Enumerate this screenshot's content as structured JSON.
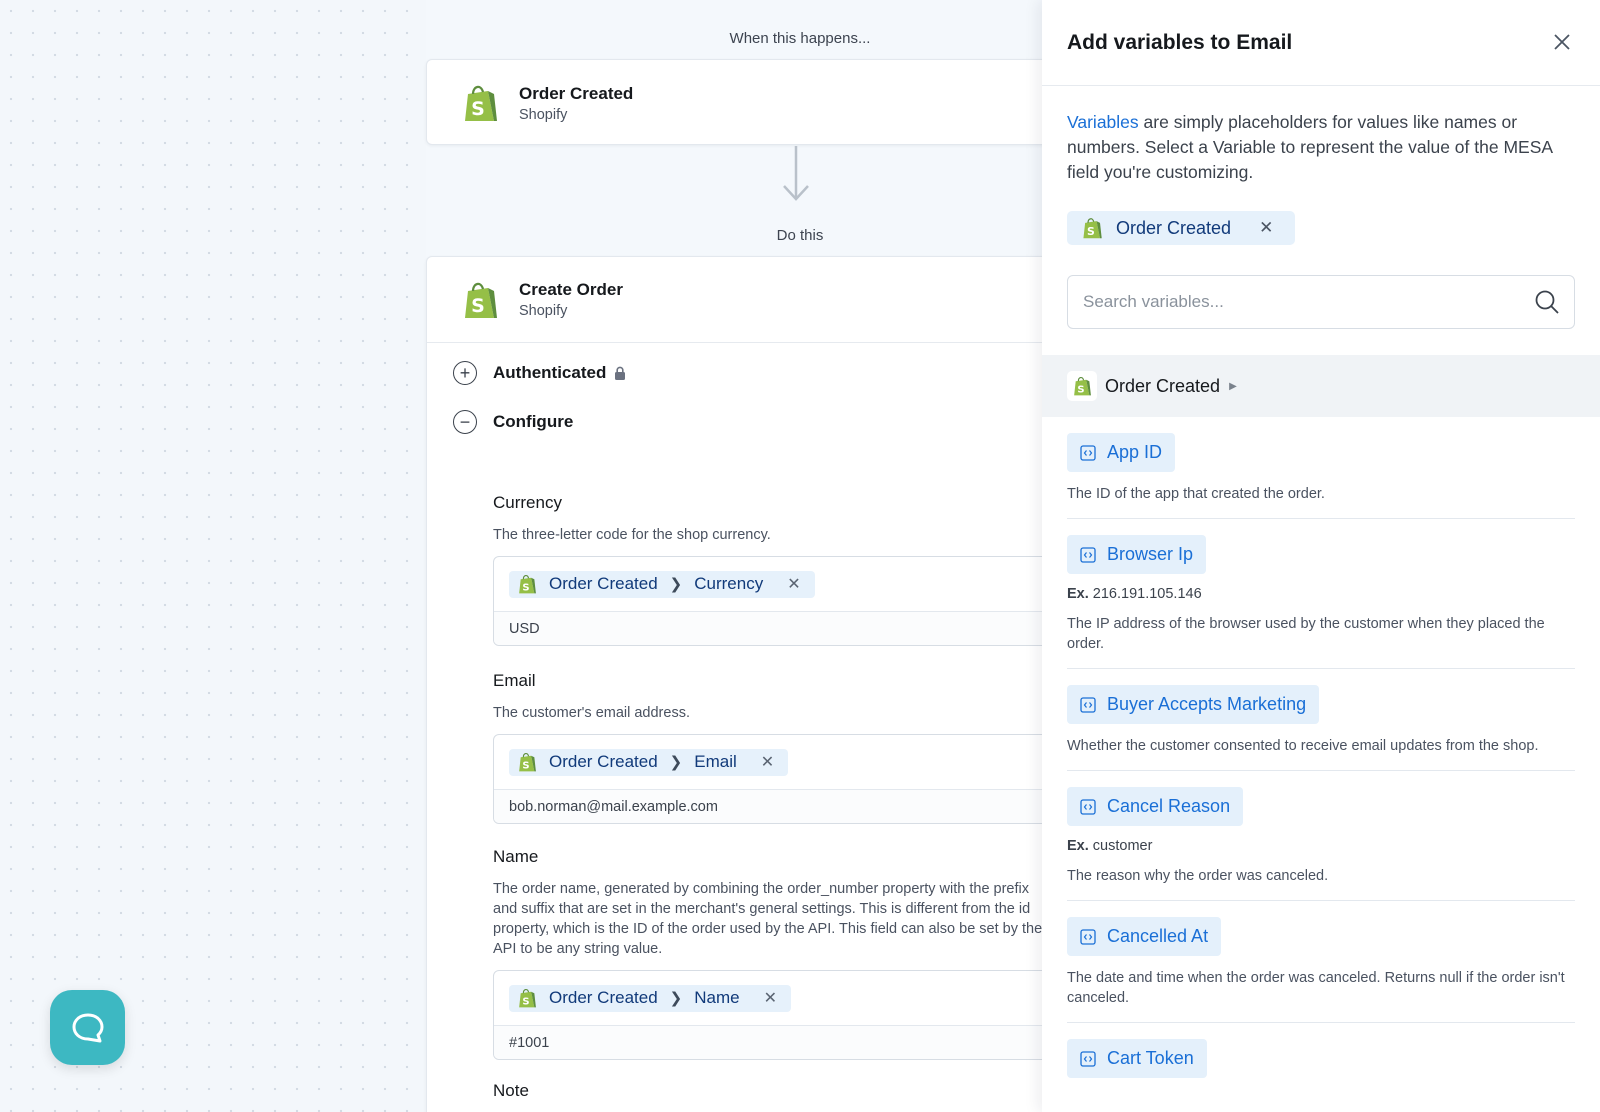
{
  "workflow": {
    "trigger_label": "When this happens...",
    "trigger": {
      "title": "Order Created",
      "subtitle": "Shopify"
    },
    "action_label": "Do this",
    "action": {
      "title": "Create Order",
      "subtitle": "Shopify"
    },
    "sections": {
      "authenticated": "Authenticated",
      "configure": "Configure"
    },
    "fields": {
      "currency": {
        "label": "Currency",
        "description": "The three-letter code for the shop currency.",
        "chip_source": "Order Created",
        "chip_field": "Currency",
        "value": "USD"
      },
      "email": {
        "label": "Email",
        "description": "The customer's email address.",
        "chip_source": "Order Created",
        "chip_field": "Email",
        "value": "bob.norman@mail.example.com"
      },
      "name": {
        "label": "Name",
        "description": "The order name, generated by combining the order_number property with the prefix and suffix that are set in the merchant's general settings. This is different from the id property, which is the ID of the order used by the API. This field can also be set by the API to be any string value.",
        "chip_source": "Order Created",
        "chip_field": "Name",
        "value": "#1001"
      },
      "note": {
        "label": "Note"
      }
    }
  },
  "panel": {
    "title": "Add variables to Email",
    "intro_link": "Variables",
    "intro_text": " are simply placeholders for values like names or numbers. Select a Variable to represent the value of the MESA field you're customizing.",
    "filter_chip": "Order Created",
    "search_placeholder": "Search variables...",
    "group": "Order Created",
    "variables": [
      {
        "name": "App ID",
        "example": "",
        "description": "The ID of the app that created the order."
      },
      {
        "name": "Browser Ip",
        "example_prefix": "Ex.",
        "example": "216.191.105.146",
        "description": "The IP address of the browser used by the customer when they placed the order."
      },
      {
        "name": "Buyer Accepts Marketing",
        "example": "",
        "description": "Whether the customer consented to receive email updates from the shop."
      },
      {
        "name": "Cancel Reason",
        "example_prefix": "Ex.",
        "example": "customer",
        "description": "The reason why the order was canceled."
      },
      {
        "name": "Cancelled At",
        "example": "",
        "description": "The date and time when the order was canceled. Returns null if the order isn't canceled."
      },
      {
        "name": "Cart Token",
        "example": "",
        "description": ""
      }
    ]
  },
  "colors": {
    "accent": "#1a6fd6",
    "chip_bg": "#e4f0fb",
    "chat": "#3db8c2",
    "shopify_green": "#95bf47"
  }
}
